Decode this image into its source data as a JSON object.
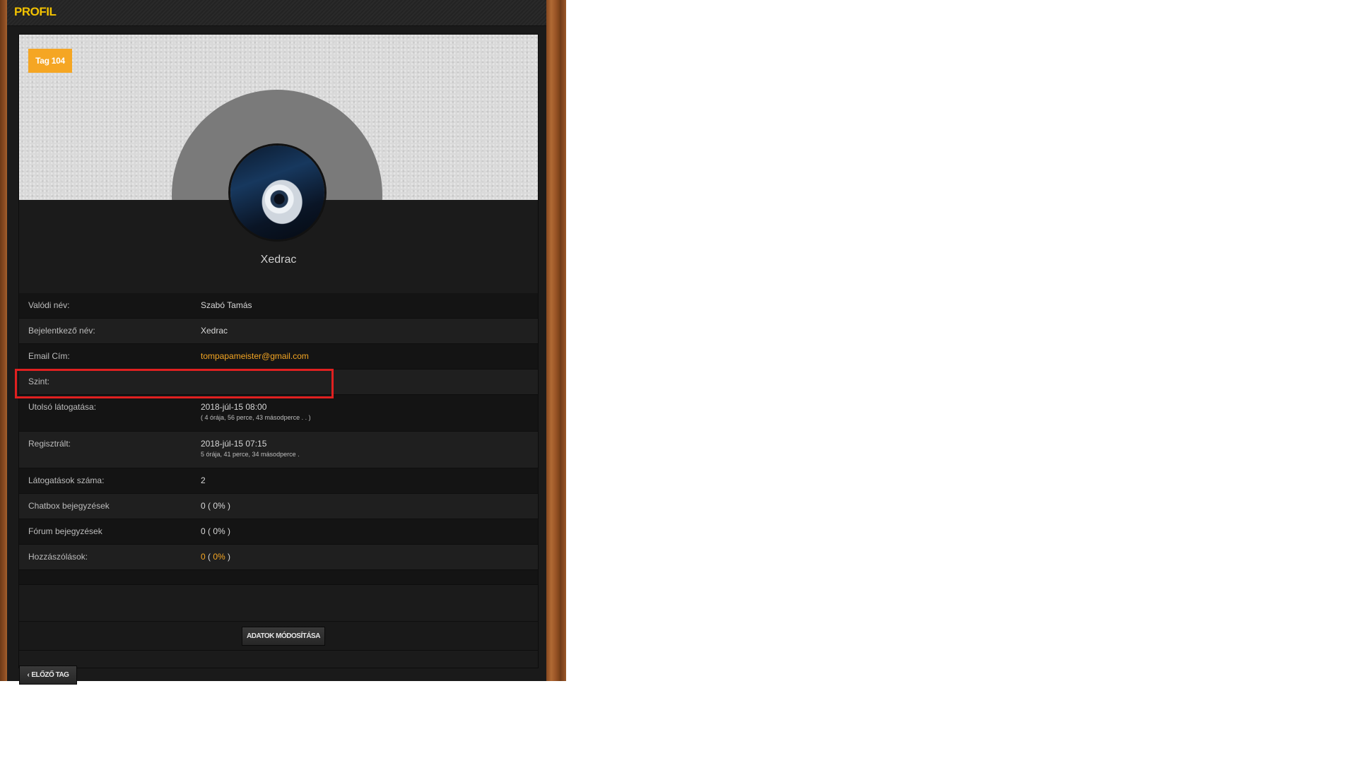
{
  "header": {
    "title": "PROFIL"
  },
  "profile": {
    "tag_badge": "Tag 104",
    "username": "Xedrac"
  },
  "rows": [
    {
      "label": "Valódi név:",
      "value": "Szabó Tamás"
    },
    {
      "label": "Bejelentkező név:",
      "value": "Xedrac"
    },
    {
      "label": "Email Cím:",
      "value": "tompapameister@gmail.com"
    },
    {
      "label": "Szint:",
      "value": ""
    },
    {
      "label": "Utolsó látogatása:",
      "value": "2018-júl-15 08:00",
      "sub": "( 4 órája, 56 perce, 43 másodperce . . )"
    },
    {
      "label": "Regisztrált:",
      "value": "2018-júl-15 07:15",
      "sub": "5 órája, 41 perce, 34 másodperce ."
    },
    {
      "label": "Látogatások száma:",
      "value": "2"
    },
    {
      "label": "Chatbox bejegyzések",
      "value": "0 ( 0% )"
    },
    {
      "label": "Fórum bejegyzések",
      "value": "0 ( 0% )"
    },
    {
      "label": "Hozzászólások:",
      "value_num": "0",
      "value_pct": "0%"
    }
  ],
  "actions": {
    "edit_label": "ADATOK MÓDOSÍTÁSA",
    "prev_label": "ELŐZŐ TAG"
  },
  "colors": {
    "accent": "#f5a623",
    "title": "#f2c200",
    "highlight": "#e02020"
  }
}
